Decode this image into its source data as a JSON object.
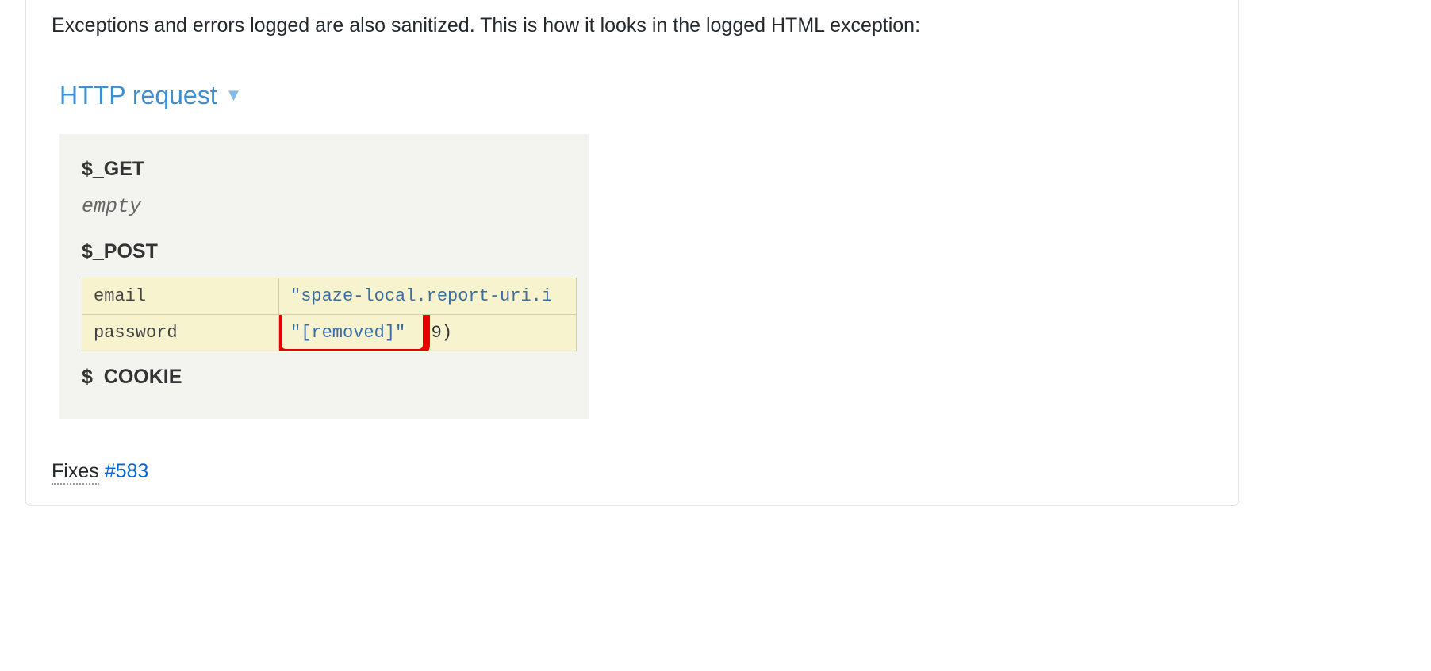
{
  "intro": "Exceptions and errors logged are also sanitized. This is how it looks in the logged HTML exception:",
  "section_title": "HTTP request",
  "panel": {
    "get_label": "$_GET",
    "get_empty": "empty",
    "post_label": "$_POST",
    "post_rows": [
      {
        "key": "email",
        "val_str": "\"spaze-local.report-uri.i",
        "val_extra": ""
      },
      {
        "key": "password",
        "val_str": "\"[removed]\"",
        "val_extra": "(9)"
      }
    ],
    "cookie_label": "$_COOKIE"
  },
  "fixes": {
    "word": "Fixes",
    "link": "#583"
  }
}
